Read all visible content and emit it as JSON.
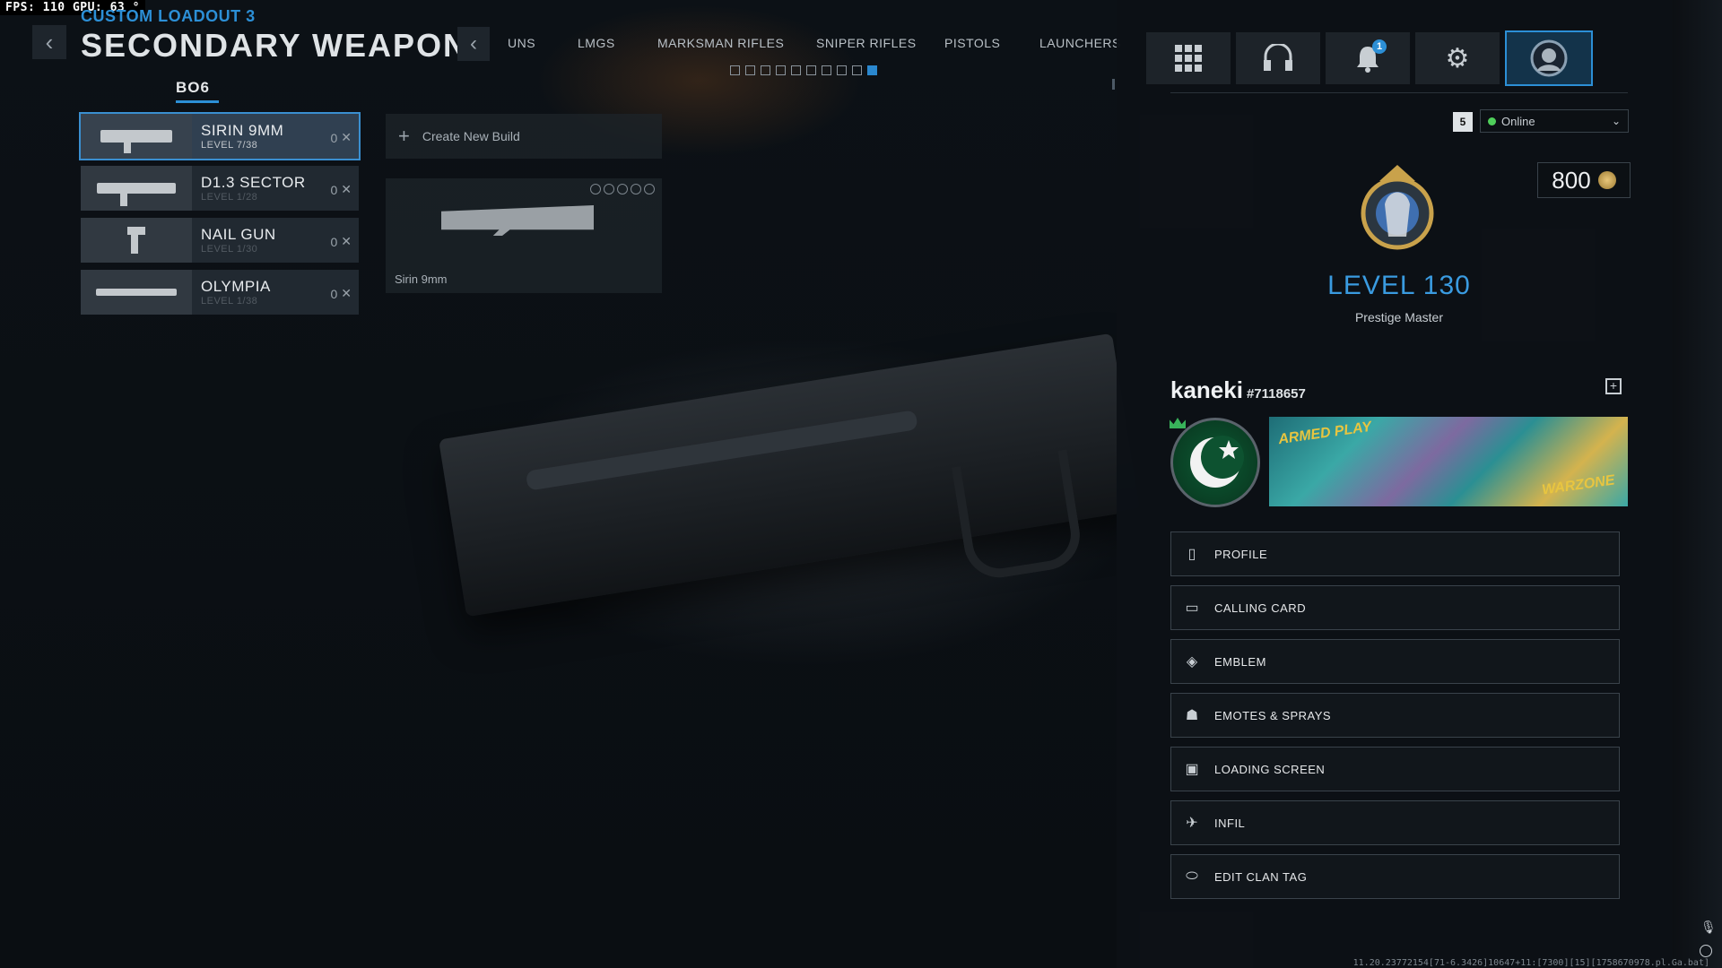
{
  "hud": {
    "fps_label": "FPS:",
    "fps": "110",
    "gpu_label": "GPU:",
    "gpu": "63",
    "gpu_unit": "°"
  },
  "header": {
    "breadcrumb": "CUSTOM LOADOUT 3",
    "title": "SECONDARY WEAPON",
    "sub_tab": "BO6"
  },
  "categories": [
    "UNS",
    "LMGS",
    "MARKSMAN RIFLES",
    "SNIPER RIFLES",
    "PISTOLS",
    "LAUNCHERS"
  ],
  "weapons": [
    {
      "name": "SIRIN 9MM",
      "level": "LEVEL 7/38",
      "count": "0"
    },
    {
      "name": "D1.3 SECTOR",
      "level": "LEVEL 1/28",
      "count": "0"
    },
    {
      "name": "NAIL GUN",
      "level": "LEVEL 1/30",
      "count": "0"
    },
    {
      "name": "OLYMPIA",
      "level": "LEVEL 1/38",
      "count": "0"
    }
  ],
  "builds": {
    "create_label": "Create New Build",
    "current_build_name": "Sirin 9mm"
  },
  "topbar": {
    "notification_count": "1"
  },
  "profile": {
    "party_size": "5",
    "status": "Online",
    "cod_points": "800",
    "level": "LEVEL 130",
    "rank": "Prestige Master",
    "username": "kaneki",
    "tag": "#7118657",
    "card_text_1": "ARMED PLAY",
    "card_text_2": "WARZONE"
  },
  "menu": [
    {
      "label": "PROFILE",
      "icon": "profile-icon"
    },
    {
      "label": "CALLING CARD",
      "icon": "calling-card-icon"
    },
    {
      "label": "EMBLEM",
      "icon": "emblem-icon"
    },
    {
      "label": "EMOTES & SPRAYS",
      "icon": "emotes-icon"
    },
    {
      "label": "LOADING SCREEN",
      "icon": "loading-screen-icon"
    },
    {
      "label": "INFIL",
      "icon": "infil-icon"
    },
    {
      "label": "EDIT CLAN TAG",
      "icon": "clan-tag-icon"
    }
  ],
  "footer": "11.20.23772154[71-6.3426]10647+11:[7300][15][1758670978.pl.Ga.bat]",
  "colors": {
    "accent": "#2c8fd6",
    "online": "#4fcf5a"
  }
}
